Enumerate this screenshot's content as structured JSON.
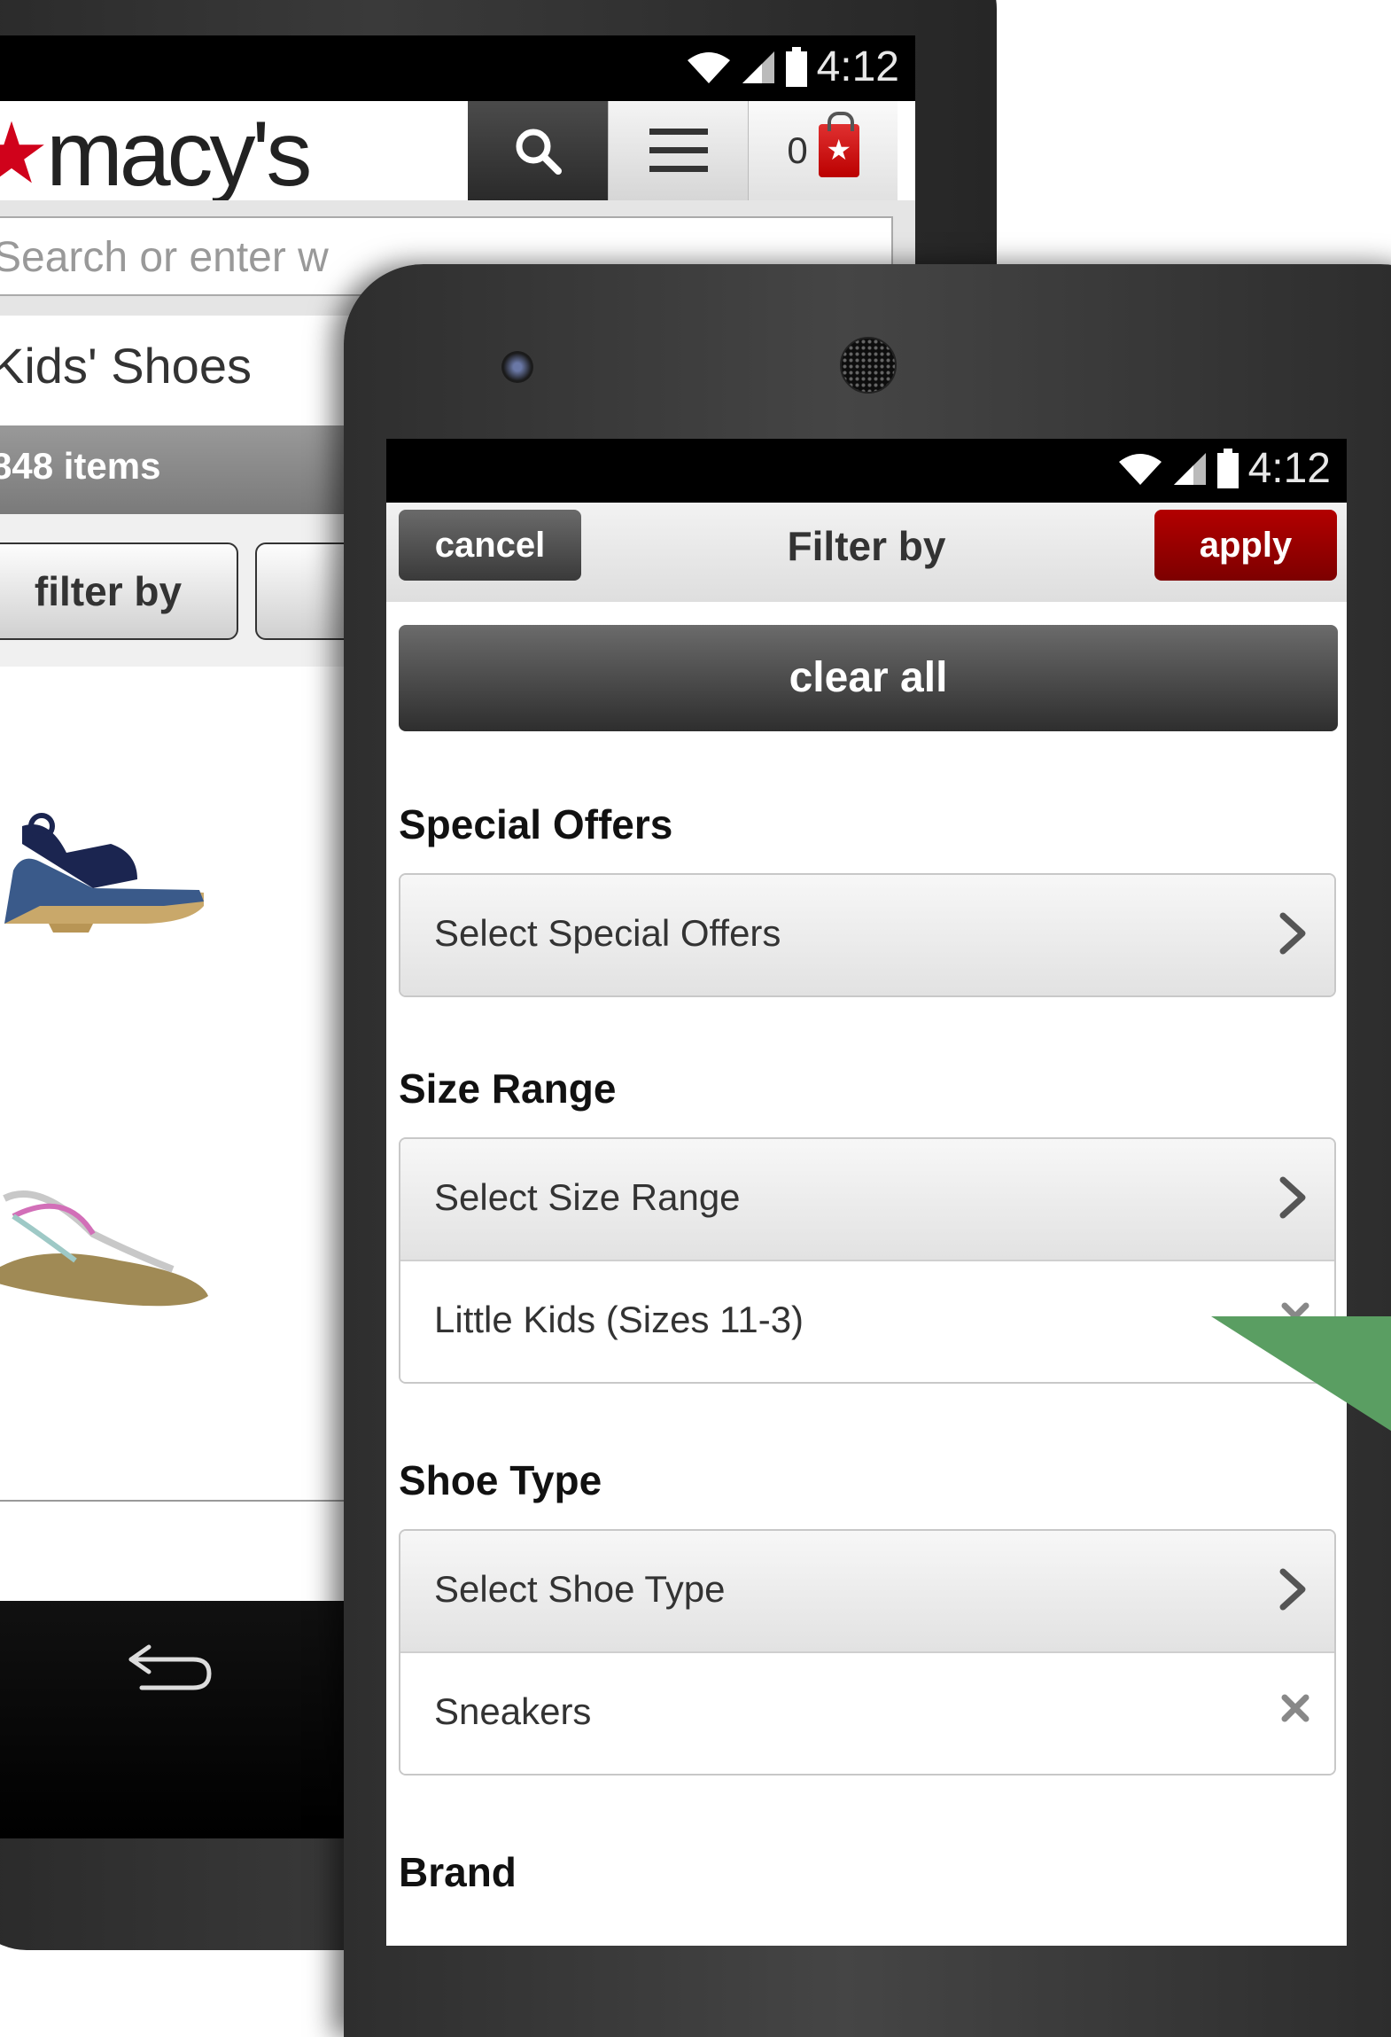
{
  "back_phone": {
    "status_time": "4:12",
    "logo": "macy's",
    "search_placeholder": "Search or enter w",
    "bag_count": "0",
    "page_title": "Kids' Shoes",
    "items_count": "848 items",
    "filter_button": "filter by"
  },
  "front_phone": {
    "status_time": "4:12",
    "header": {
      "cancel": "cancel",
      "title": "Filter by",
      "apply": "apply"
    },
    "clear_all": "clear all",
    "sections": {
      "special_offers": {
        "label": "Special Offers",
        "select": "Select Special Offers"
      },
      "size_range": {
        "label": "Size Range",
        "select": "Select Size Range",
        "selected": "Little Kids (Sizes 11-3)"
      },
      "shoe_type": {
        "label": "Shoe Type",
        "select": "Select Shoe Type",
        "selected": "Sneakers"
      },
      "brand": {
        "label": "Brand"
      }
    }
  },
  "colors": {
    "brand_red": "#d0021b",
    "apply_red": "#990000",
    "pointer_green": "#5a9e62"
  }
}
